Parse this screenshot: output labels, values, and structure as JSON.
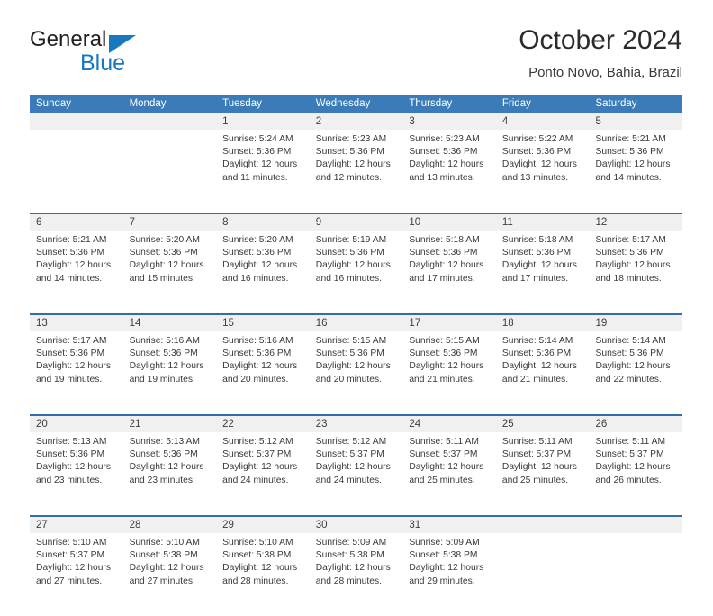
{
  "brand": {
    "name_dark": "General",
    "name_blue": "Blue",
    "accent_color": "#1878be"
  },
  "header": {
    "title": "October 2024",
    "subtitle": "Ponto Novo, Bahia, Brazil"
  },
  "theme": {
    "header_bar": "#3b7cb8",
    "week_separator": "#2f6ea9",
    "daynum_band": "#f0f0f0",
    "text": "#3a3a3a"
  },
  "weekdays": [
    "Sunday",
    "Monday",
    "Tuesday",
    "Wednesday",
    "Thursday",
    "Friday",
    "Saturday"
  ],
  "weeks": [
    [
      {
        "day": "",
        "empty": true,
        "sunrise": "",
        "sunset": "",
        "daylight1": "",
        "daylight2": ""
      },
      {
        "day": "",
        "empty": true,
        "sunrise": "",
        "sunset": "",
        "daylight1": "",
        "daylight2": ""
      },
      {
        "day": "1",
        "empty": false,
        "sunrise": "Sunrise: 5:24 AM",
        "sunset": "Sunset: 5:36 PM",
        "daylight1": "Daylight: 12 hours",
        "daylight2": "and 11 minutes."
      },
      {
        "day": "2",
        "empty": false,
        "sunrise": "Sunrise: 5:23 AM",
        "sunset": "Sunset: 5:36 PM",
        "daylight1": "Daylight: 12 hours",
        "daylight2": "and 12 minutes."
      },
      {
        "day": "3",
        "empty": false,
        "sunrise": "Sunrise: 5:23 AM",
        "sunset": "Sunset: 5:36 PM",
        "daylight1": "Daylight: 12 hours",
        "daylight2": "and 13 minutes."
      },
      {
        "day": "4",
        "empty": false,
        "sunrise": "Sunrise: 5:22 AM",
        "sunset": "Sunset: 5:36 PM",
        "daylight1": "Daylight: 12 hours",
        "daylight2": "and 13 minutes."
      },
      {
        "day": "5",
        "empty": false,
        "sunrise": "Sunrise: 5:21 AM",
        "sunset": "Sunset: 5:36 PM",
        "daylight1": "Daylight: 12 hours",
        "daylight2": "and 14 minutes."
      }
    ],
    [
      {
        "day": "6",
        "empty": false,
        "sunrise": "Sunrise: 5:21 AM",
        "sunset": "Sunset: 5:36 PM",
        "daylight1": "Daylight: 12 hours",
        "daylight2": "and 14 minutes."
      },
      {
        "day": "7",
        "empty": false,
        "sunrise": "Sunrise: 5:20 AM",
        "sunset": "Sunset: 5:36 PM",
        "daylight1": "Daylight: 12 hours",
        "daylight2": "and 15 minutes."
      },
      {
        "day": "8",
        "empty": false,
        "sunrise": "Sunrise: 5:20 AM",
        "sunset": "Sunset: 5:36 PM",
        "daylight1": "Daylight: 12 hours",
        "daylight2": "and 16 minutes."
      },
      {
        "day": "9",
        "empty": false,
        "sunrise": "Sunrise: 5:19 AM",
        "sunset": "Sunset: 5:36 PM",
        "daylight1": "Daylight: 12 hours",
        "daylight2": "and 16 minutes."
      },
      {
        "day": "10",
        "empty": false,
        "sunrise": "Sunrise: 5:18 AM",
        "sunset": "Sunset: 5:36 PM",
        "daylight1": "Daylight: 12 hours",
        "daylight2": "and 17 minutes."
      },
      {
        "day": "11",
        "empty": false,
        "sunrise": "Sunrise: 5:18 AM",
        "sunset": "Sunset: 5:36 PM",
        "daylight1": "Daylight: 12 hours",
        "daylight2": "and 17 minutes."
      },
      {
        "day": "12",
        "empty": false,
        "sunrise": "Sunrise: 5:17 AM",
        "sunset": "Sunset: 5:36 PM",
        "daylight1": "Daylight: 12 hours",
        "daylight2": "and 18 minutes."
      }
    ],
    [
      {
        "day": "13",
        "empty": false,
        "sunrise": "Sunrise: 5:17 AM",
        "sunset": "Sunset: 5:36 PM",
        "daylight1": "Daylight: 12 hours",
        "daylight2": "and 19 minutes."
      },
      {
        "day": "14",
        "empty": false,
        "sunrise": "Sunrise: 5:16 AM",
        "sunset": "Sunset: 5:36 PM",
        "daylight1": "Daylight: 12 hours",
        "daylight2": "and 19 minutes."
      },
      {
        "day": "15",
        "empty": false,
        "sunrise": "Sunrise: 5:16 AM",
        "sunset": "Sunset: 5:36 PM",
        "daylight1": "Daylight: 12 hours",
        "daylight2": "and 20 minutes."
      },
      {
        "day": "16",
        "empty": false,
        "sunrise": "Sunrise: 5:15 AM",
        "sunset": "Sunset: 5:36 PM",
        "daylight1": "Daylight: 12 hours",
        "daylight2": "and 20 minutes."
      },
      {
        "day": "17",
        "empty": false,
        "sunrise": "Sunrise: 5:15 AM",
        "sunset": "Sunset: 5:36 PM",
        "daylight1": "Daylight: 12 hours",
        "daylight2": "and 21 minutes."
      },
      {
        "day": "18",
        "empty": false,
        "sunrise": "Sunrise: 5:14 AM",
        "sunset": "Sunset: 5:36 PM",
        "daylight1": "Daylight: 12 hours",
        "daylight2": "and 21 minutes."
      },
      {
        "day": "19",
        "empty": false,
        "sunrise": "Sunrise: 5:14 AM",
        "sunset": "Sunset: 5:36 PM",
        "daylight1": "Daylight: 12 hours",
        "daylight2": "and 22 minutes."
      }
    ],
    [
      {
        "day": "20",
        "empty": false,
        "sunrise": "Sunrise: 5:13 AM",
        "sunset": "Sunset: 5:36 PM",
        "daylight1": "Daylight: 12 hours",
        "daylight2": "and 23 minutes."
      },
      {
        "day": "21",
        "empty": false,
        "sunrise": "Sunrise: 5:13 AM",
        "sunset": "Sunset: 5:36 PM",
        "daylight1": "Daylight: 12 hours",
        "daylight2": "and 23 minutes."
      },
      {
        "day": "22",
        "empty": false,
        "sunrise": "Sunrise: 5:12 AM",
        "sunset": "Sunset: 5:37 PM",
        "daylight1": "Daylight: 12 hours",
        "daylight2": "and 24 minutes."
      },
      {
        "day": "23",
        "empty": false,
        "sunrise": "Sunrise: 5:12 AM",
        "sunset": "Sunset: 5:37 PM",
        "daylight1": "Daylight: 12 hours",
        "daylight2": "and 24 minutes."
      },
      {
        "day": "24",
        "empty": false,
        "sunrise": "Sunrise: 5:11 AM",
        "sunset": "Sunset: 5:37 PM",
        "daylight1": "Daylight: 12 hours",
        "daylight2": "and 25 minutes."
      },
      {
        "day": "25",
        "empty": false,
        "sunrise": "Sunrise: 5:11 AM",
        "sunset": "Sunset: 5:37 PM",
        "daylight1": "Daylight: 12 hours",
        "daylight2": "and 25 minutes."
      },
      {
        "day": "26",
        "empty": false,
        "sunrise": "Sunrise: 5:11 AM",
        "sunset": "Sunset: 5:37 PM",
        "daylight1": "Daylight: 12 hours",
        "daylight2": "and 26 minutes."
      }
    ],
    [
      {
        "day": "27",
        "empty": false,
        "sunrise": "Sunrise: 5:10 AM",
        "sunset": "Sunset: 5:37 PM",
        "daylight1": "Daylight: 12 hours",
        "daylight2": "and 27 minutes."
      },
      {
        "day": "28",
        "empty": false,
        "sunrise": "Sunrise: 5:10 AM",
        "sunset": "Sunset: 5:38 PM",
        "daylight1": "Daylight: 12 hours",
        "daylight2": "and 27 minutes."
      },
      {
        "day": "29",
        "empty": false,
        "sunrise": "Sunrise: 5:10 AM",
        "sunset": "Sunset: 5:38 PM",
        "daylight1": "Daylight: 12 hours",
        "daylight2": "and 28 minutes."
      },
      {
        "day": "30",
        "empty": false,
        "sunrise": "Sunrise: 5:09 AM",
        "sunset": "Sunset: 5:38 PM",
        "daylight1": "Daylight: 12 hours",
        "daylight2": "and 28 minutes."
      },
      {
        "day": "31",
        "empty": false,
        "sunrise": "Sunrise: 5:09 AM",
        "sunset": "Sunset: 5:38 PM",
        "daylight1": "Daylight: 12 hours",
        "daylight2": "and 29 minutes."
      },
      {
        "day": "",
        "empty": true,
        "sunrise": "",
        "sunset": "",
        "daylight1": "",
        "daylight2": ""
      },
      {
        "day": "",
        "empty": true,
        "sunrise": "",
        "sunset": "",
        "daylight1": "",
        "daylight2": ""
      }
    ]
  ]
}
